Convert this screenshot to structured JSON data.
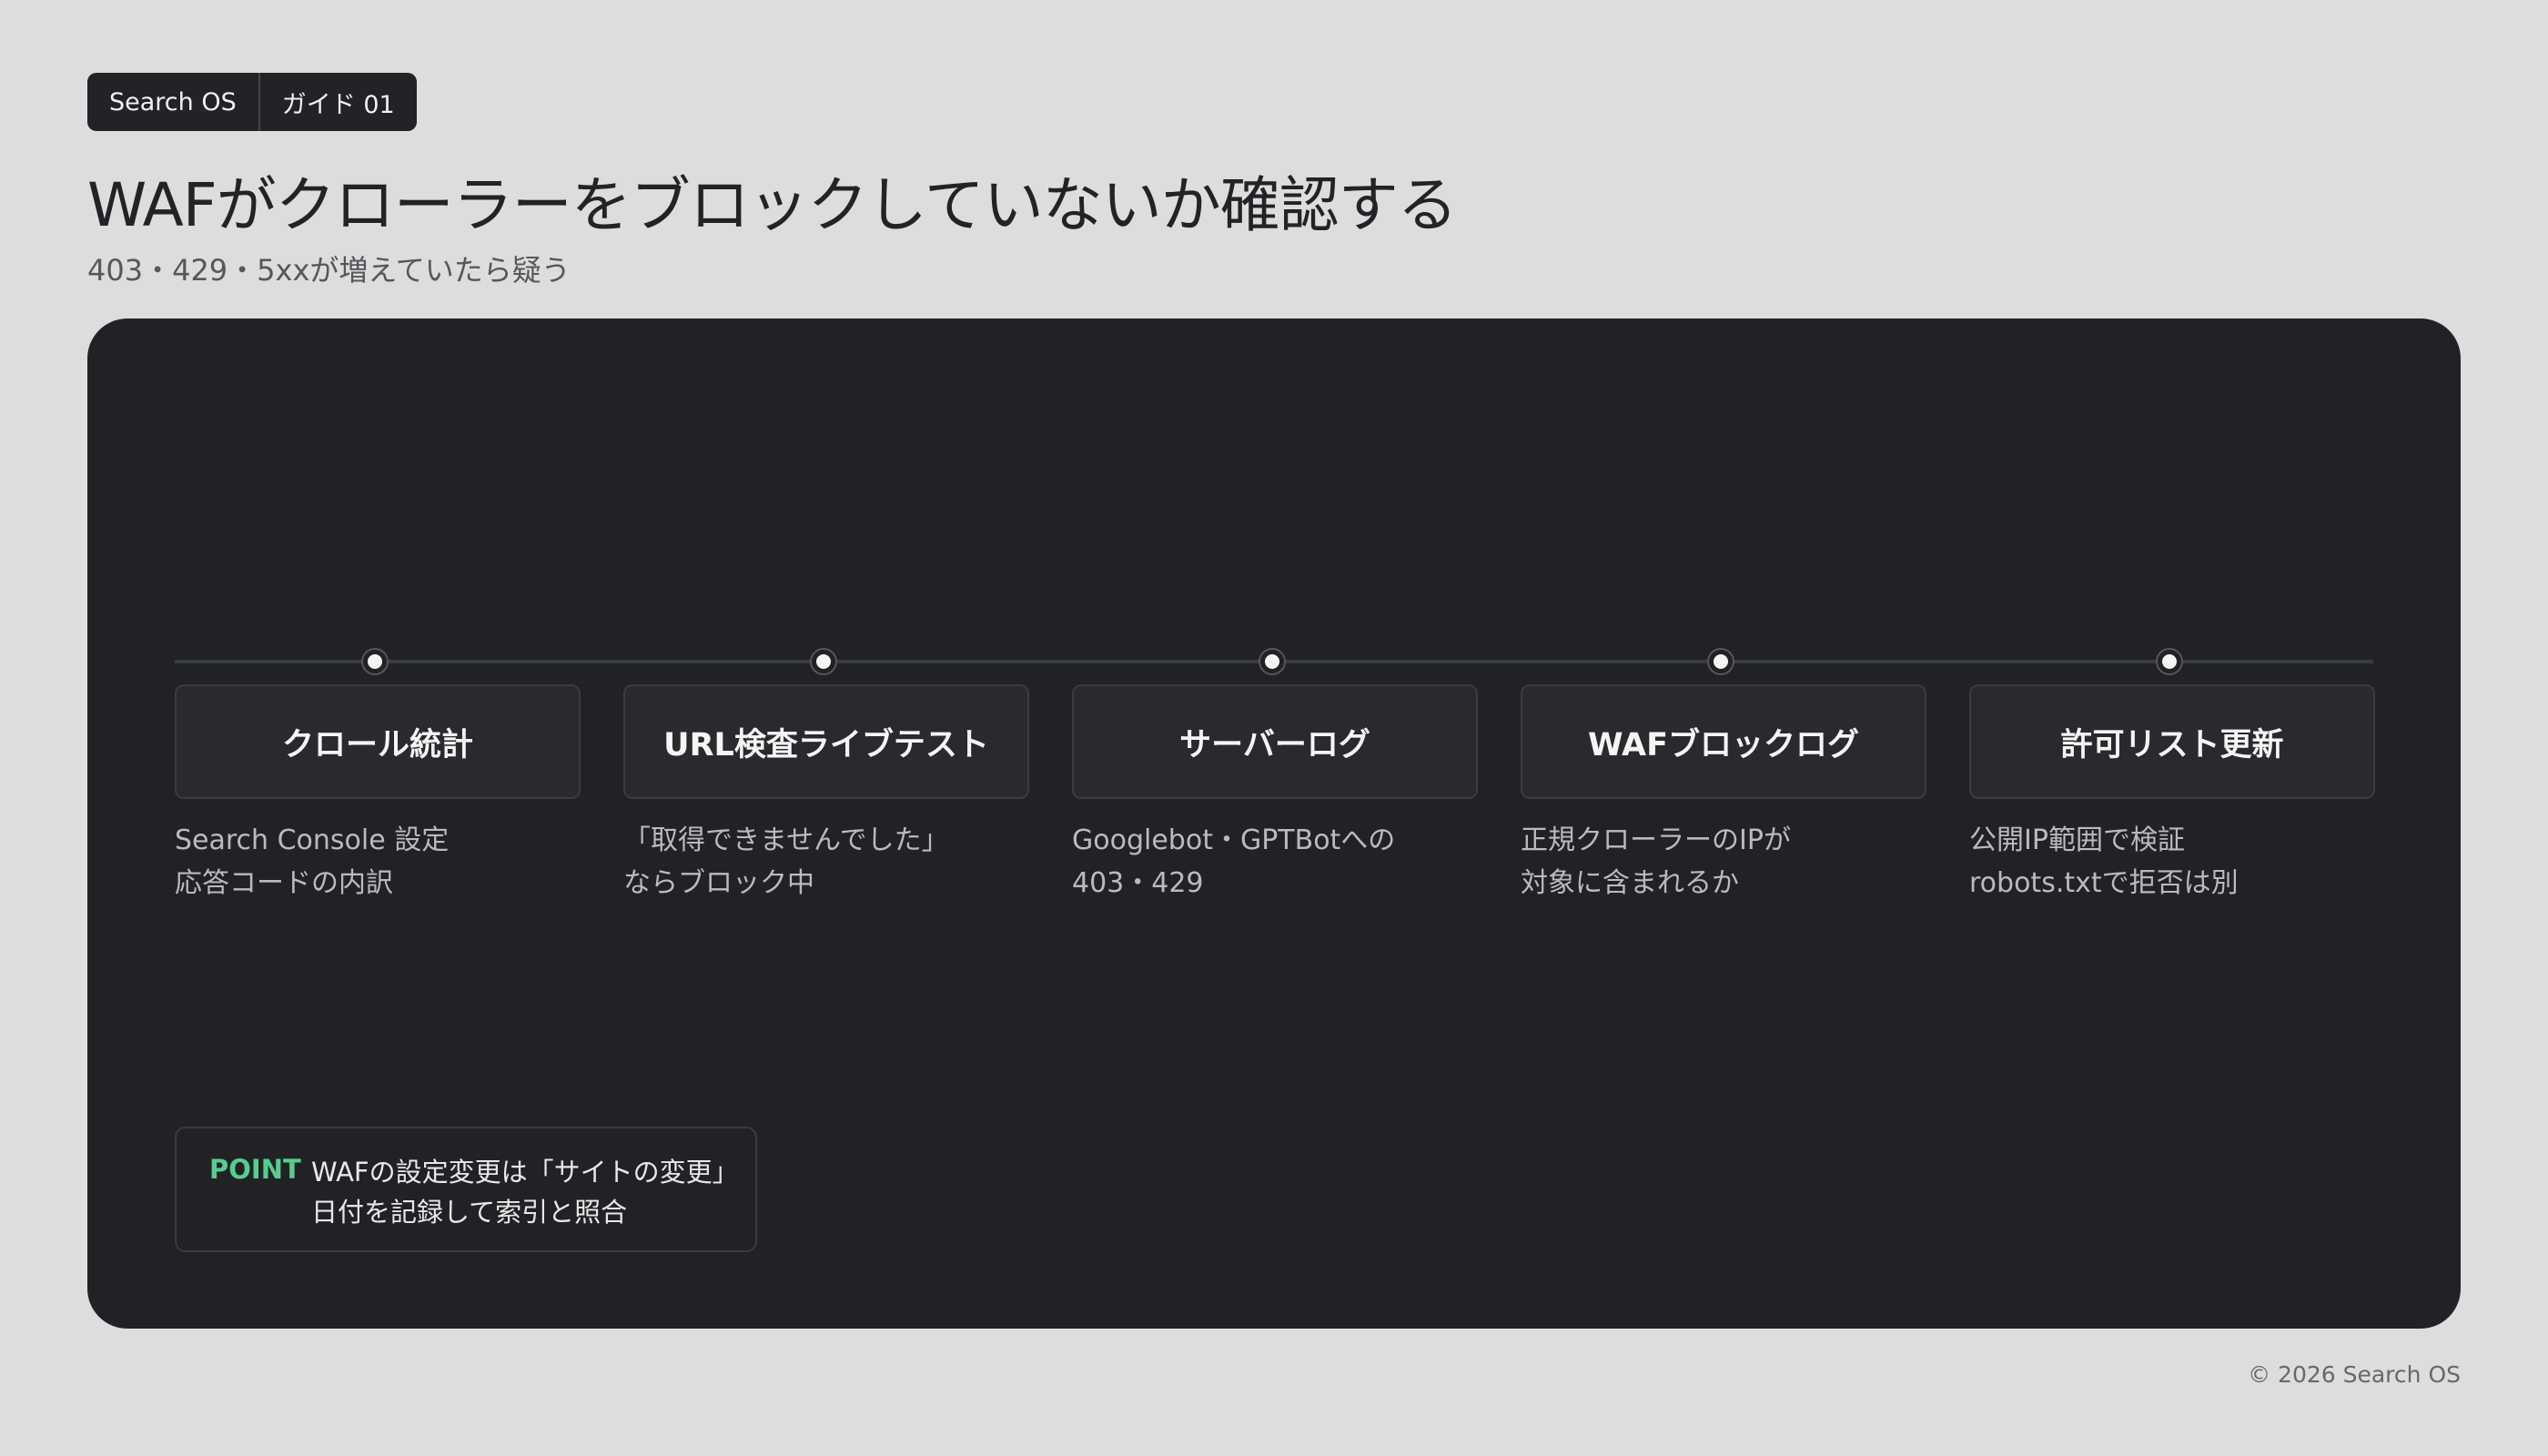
{
  "tags": [
    "Search OS",
    "ガイド 01"
  ],
  "title": "WAFがクローラーをブロックしていないか確認する",
  "subtitle": "403・429・5xxが増えていたら疑う",
  "steps": [
    {
      "label": "クロール統計",
      "desc": [
        "Search Console 設定",
        "応答コードの内訳"
      ]
    },
    {
      "label": "URL検査ライブテスト",
      "desc": [
        "「取得できませんでした」",
        "ならブロック中"
      ]
    },
    {
      "label": "サーバーログ",
      "desc": [
        "Googlebot・GPTBotへの",
        "403・429"
      ]
    },
    {
      "label": "WAFブロックログ",
      "desc": [
        "正規クローラーのIPが",
        "対象に含まれるか"
      ]
    },
    {
      "label": "許可リスト更新",
      "desc": [
        "公開IP範囲で検証",
        "robots.txtで拒否は別"
      ]
    }
  ],
  "point": {
    "label": "POINT",
    "lines": [
      "WAFの設定変更は「サイトの変更」",
      "日付を記録して索引と照合"
    ]
  },
  "footer": "© 2026 Search OS",
  "colors": {
    "background": "#dddddd",
    "panel": "#212226",
    "accent": "#58cc8f"
  }
}
